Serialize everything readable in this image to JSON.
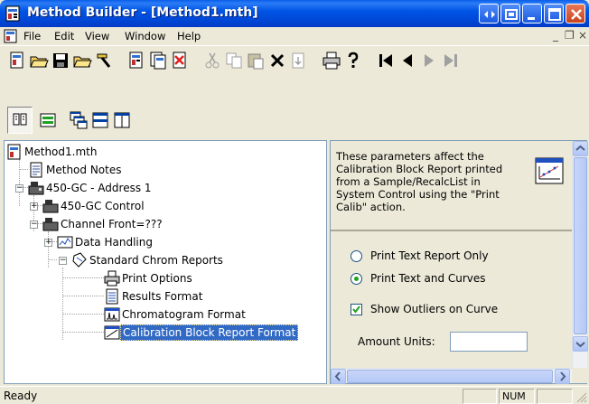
{
  "window": {
    "title": "Method Builder - [Method1.mth]"
  },
  "menu": {
    "items": [
      "File",
      "Edit",
      "View",
      "Window",
      "Help"
    ],
    "mdi_min": "_",
    "mdi_restore": "❐",
    "mdi_close": "×"
  },
  "tree": {
    "items": [
      {
        "label": "Method1.mth"
      },
      {
        "label": "Method Notes"
      },
      {
        "label": "450-GC - Address 1"
      },
      {
        "label": "450-GC Control"
      },
      {
        "label": "Channel Front=???"
      },
      {
        "label": "Data Handling"
      },
      {
        "label": "Standard Chrom Reports"
      },
      {
        "label": "Print Options"
      },
      {
        "label": "Results Format"
      },
      {
        "label": "Chromatogram Format"
      },
      {
        "label": "Calibration Block Report Format"
      }
    ]
  },
  "panel": {
    "description": "These parameters affect the Calibration Block Report printed from a Sample/RecalcList in System Control using the \"Print Calib\" action.",
    "options": {
      "radio_text_only": "Print Text Report Only",
      "radio_text_curves": "Print Text and Curves",
      "checkbox_outliers": "Show Outliers on Curve",
      "amount_units_label": "Amount Units:",
      "amount_units_value": ""
    },
    "selected_radio": "radio_text_curves",
    "outliers_checked": true
  },
  "status": {
    "text": "Ready",
    "num": "NUM"
  },
  "colors": {
    "titlebar": "#0055e5",
    "selection": "#316ac5",
    "window_bg": "#ece9d8"
  }
}
